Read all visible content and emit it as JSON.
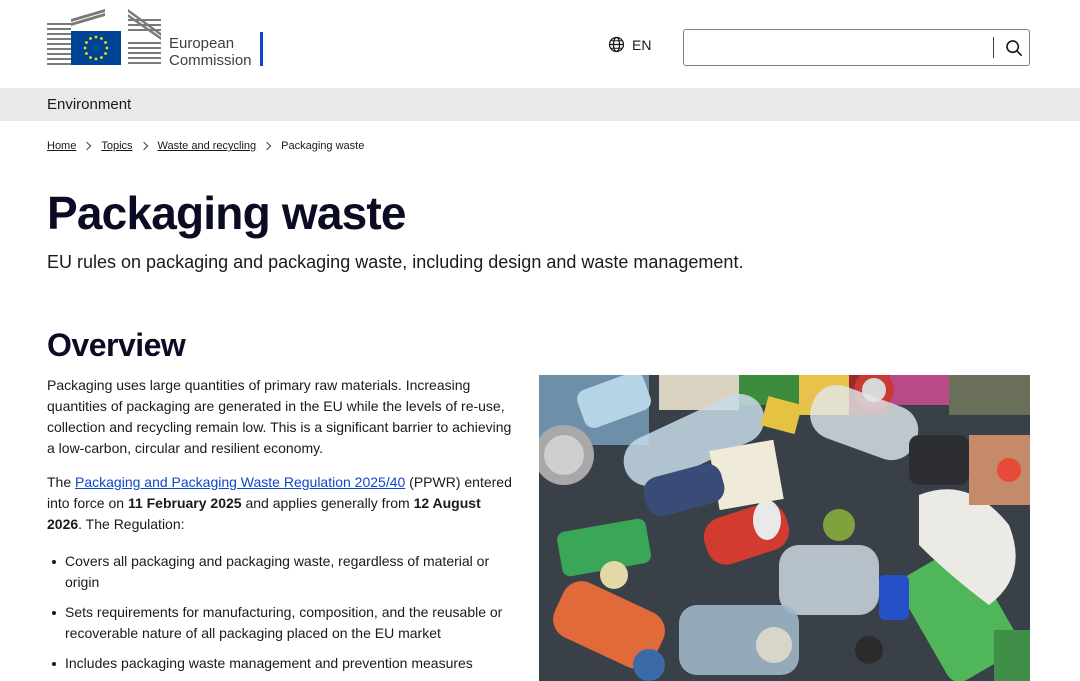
{
  "header": {
    "logo_line1": "European",
    "logo_line2": "Commission",
    "language": "EN",
    "search_placeholder": "",
    "search_value": ""
  },
  "site": {
    "name": "Environment"
  },
  "breadcrumb": {
    "items": [
      "Home",
      "Topics",
      "Waste and recycling"
    ],
    "current": "Packaging waste"
  },
  "page": {
    "title": "Packaging waste",
    "subtitle": "EU rules on packaging and packaging waste, including design and waste management."
  },
  "overview": {
    "heading": "Overview",
    "para1": "Packaging uses large quantities of primary raw materials. Increasing quantities of packaging are generated in the EU while the levels of re-use, collection and recycling remain low.  This is a significant barrier to achieving a low-carbon, circular and resilient economy.",
    "para2_prefix": "The ",
    "para2_link": "Packaging and Packaging Waste Regulation 2025/40",
    "para2_mid1": " (PPWR) entered into force on ",
    "para2_date1": "11 February 2025",
    "para2_mid2": " and applies generally from ",
    "para2_date2": "12 August 2026",
    "para2_suffix": ". The Regulation:",
    "bullets": [
      "Covers all packaging and packaging waste, regardless of material or origin",
      "Sets requirements for manufacturing, composition, and the reusable or recoverable nature of all packaging placed on the EU market",
      "Includes packaging waste management and prevention measures"
    ]
  },
  "colors": {
    "brand_blue": "#0e47cb",
    "eu_flag_blue": "#004494",
    "eu_star_yellow": "#ffd617",
    "heading": "#0b0b23"
  }
}
